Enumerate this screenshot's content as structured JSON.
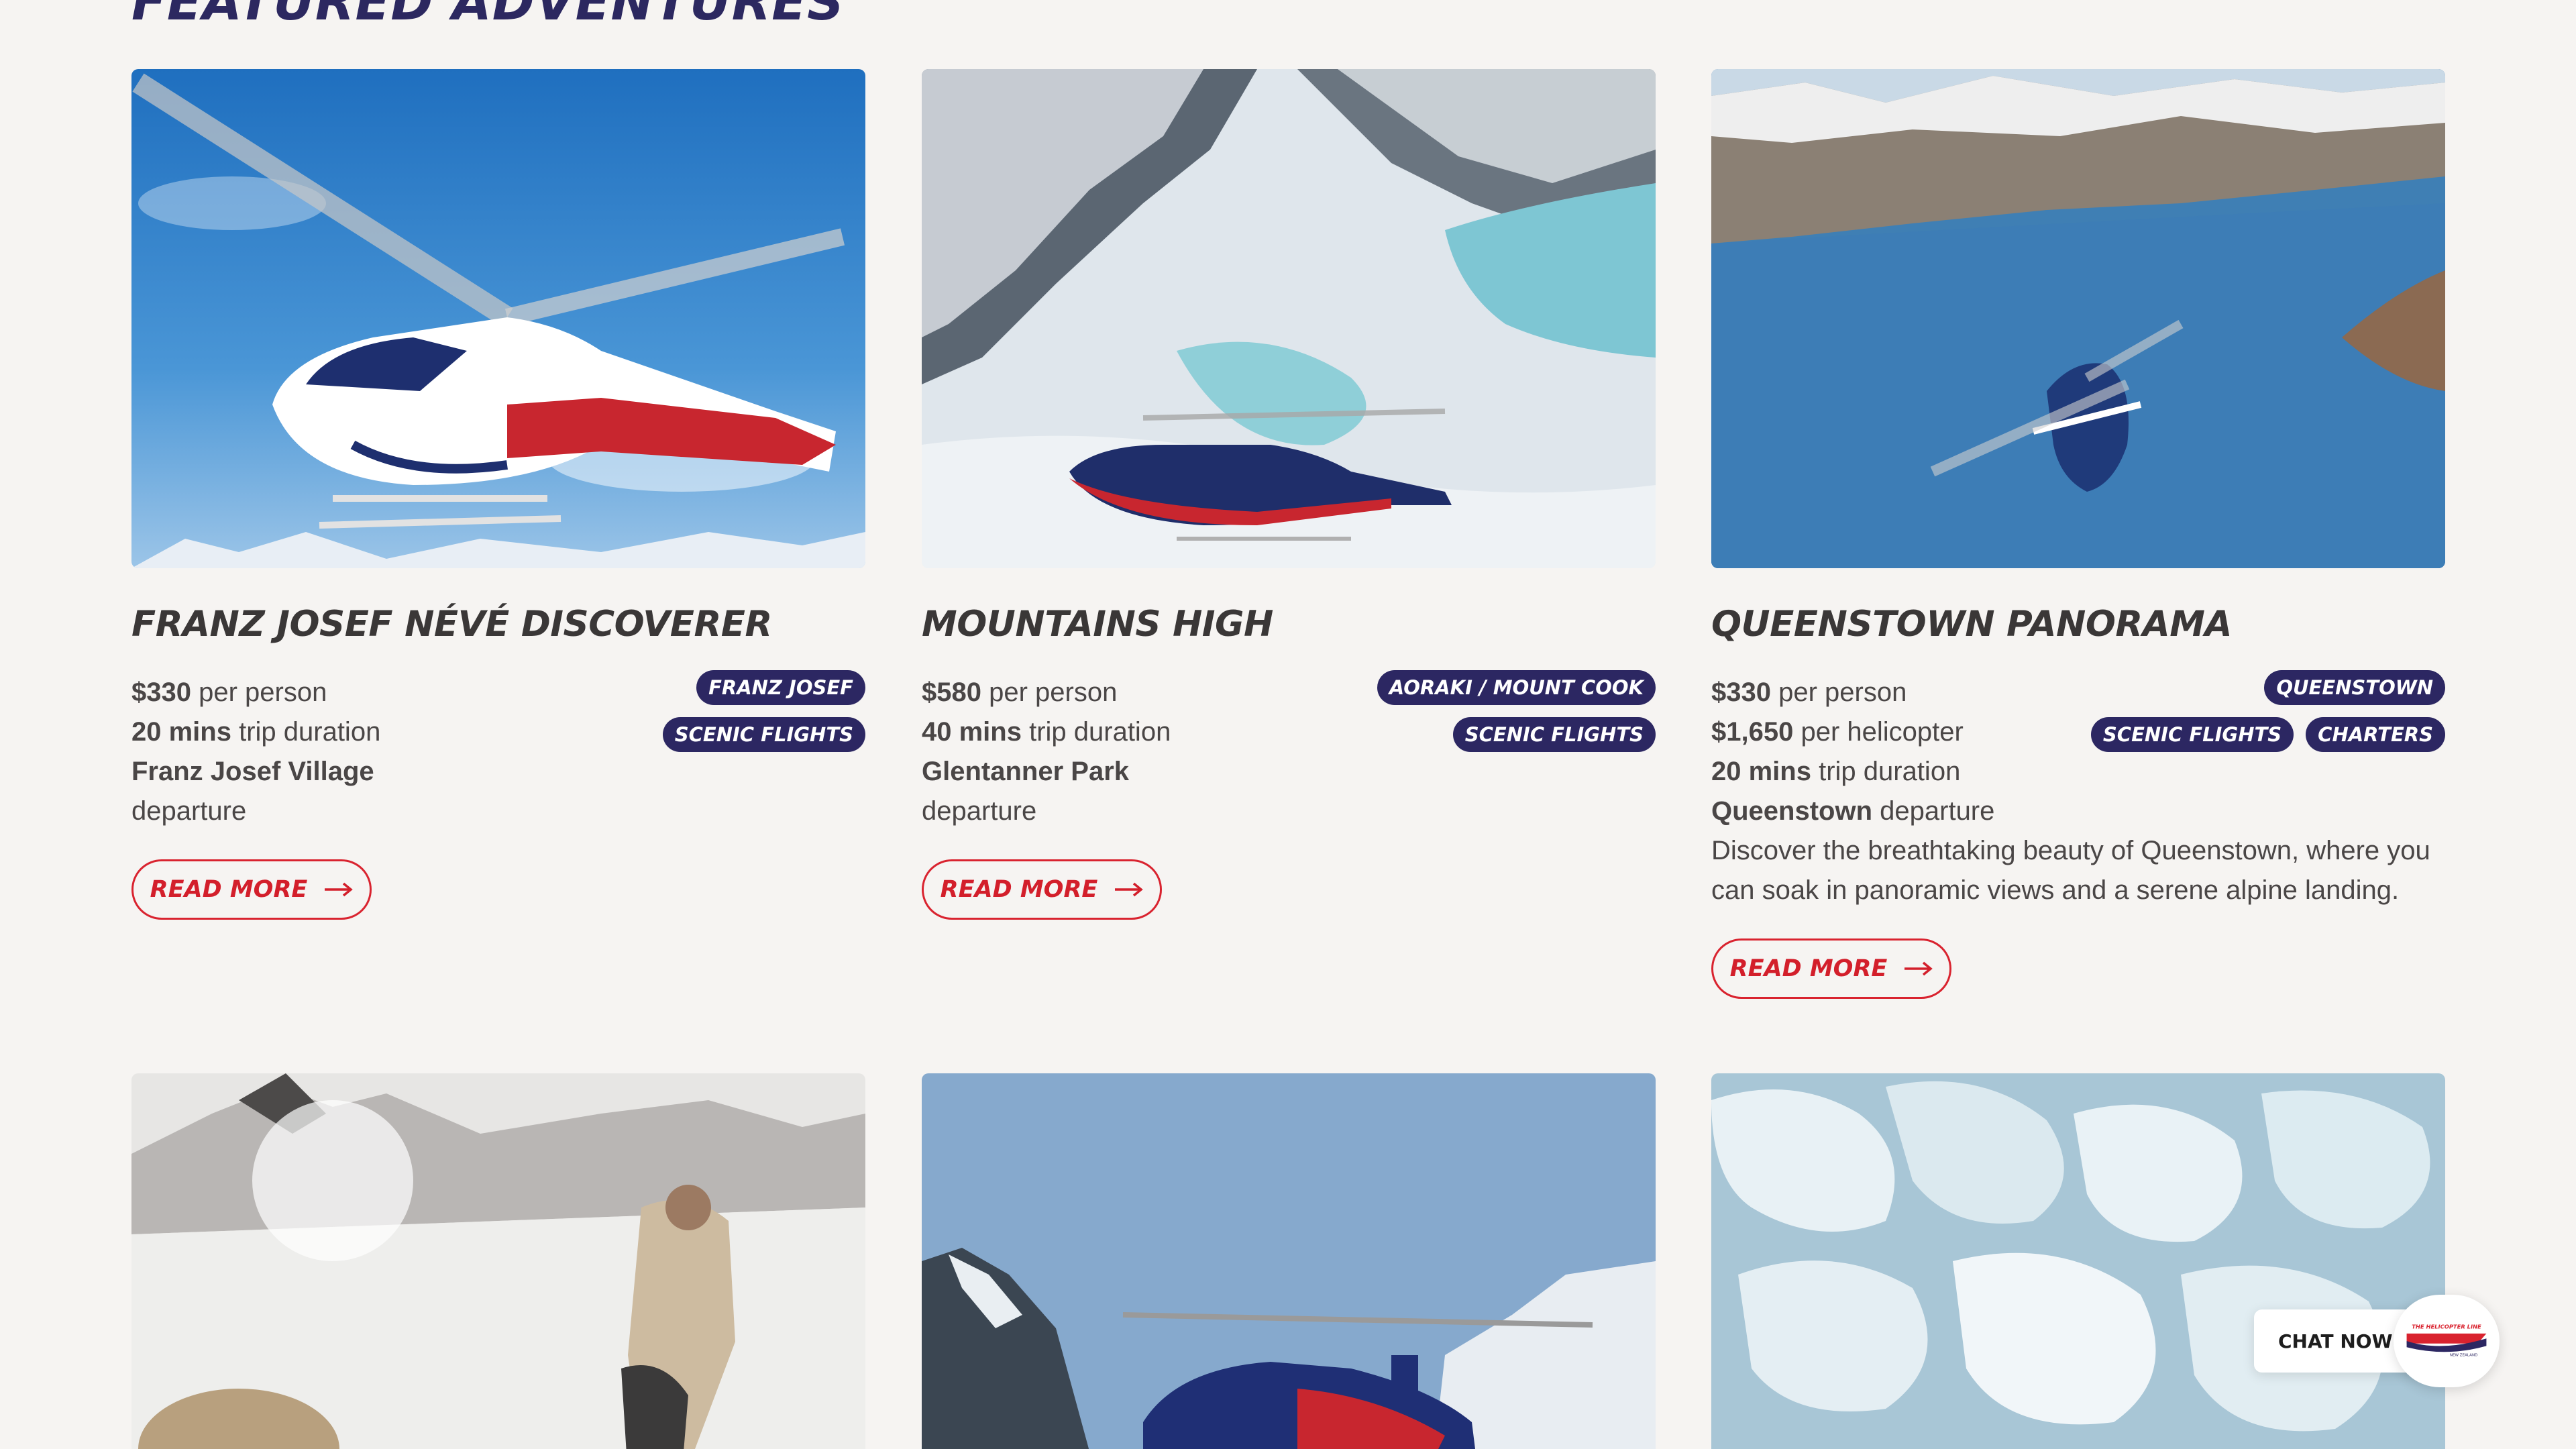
{
  "section": {
    "title": "FEATURED ADVENTURES"
  },
  "cards": [
    {
      "title": "FRANZ JOSEF NÉVÉ DISCOVERER",
      "tags": [
        "FRANZ JOSEF",
        "SCENIC FLIGHTS"
      ],
      "facts": [
        {
          "strong": "$330",
          "rest": " per person"
        },
        {
          "strong": "20 mins",
          "rest": " trip duration"
        },
        {
          "strong": "Franz Josef Village",
          "rest": ""
        },
        {
          "strong": "",
          "rest": "departure"
        }
      ],
      "cta": "READ MORE"
    },
    {
      "title": "MOUNTAINS HIGH",
      "tags": [
        "AORAKI / MOUNT COOK",
        "SCENIC FLIGHTS"
      ],
      "facts": [
        {
          "strong": "$580",
          "rest": " per person"
        },
        {
          "strong": "40 mins",
          "rest": " trip duration"
        },
        {
          "strong": "Glentanner Park",
          "rest": ""
        },
        {
          "strong": "",
          "rest": "departure"
        }
      ],
      "cta": "READ MORE"
    },
    {
      "title": "QUEENSTOWN PANORAMA",
      "tags": [
        "QUEENSTOWN",
        "SCENIC FLIGHTS",
        "CHARTERS"
      ],
      "facts": [
        {
          "strong": "$330",
          "rest": " per person"
        },
        {
          "strong": "$1,650",
          "rest": " per helicopter"
        },
        {
          "strong": "20 mins",
          "rest": " trip duration"
        },
        {
          "strong": "Queenstown",
          "rest": " departure"
        }
      ],
      "description": "Discover the breathtaking beauty of Queenstown, where you can soak in panoramic views and a serene alpine landing.",
      "cta": "READ MORE"
    }
  ],
  "chat": {
    "label": "CHAT NOW!"
  },
  "brand": {
    "logo_text_1": "THE HELICOPTER LINE",
    "logo_text_2": "NEW ZEALAND"
  },
  "colors": {
    "navy": "#2c2762",
    "red": "#d9232f",
    "background": "#f6f4f2"
  }
}
